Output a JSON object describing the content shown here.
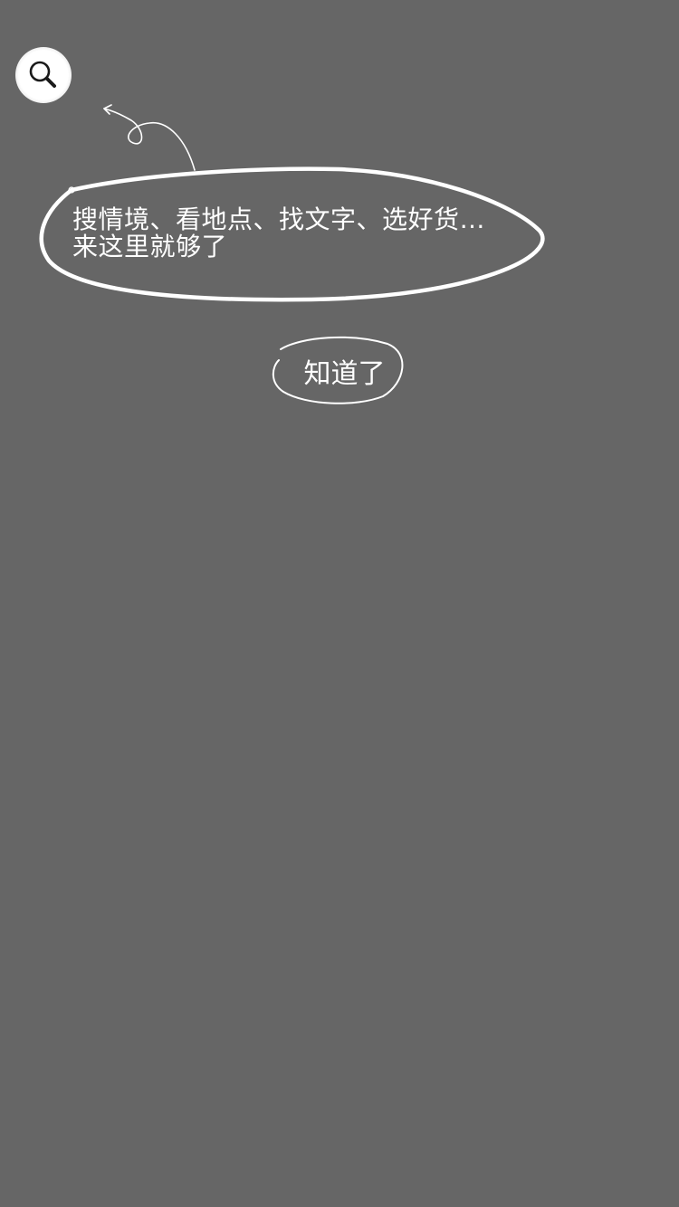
{
  "guide": {
    "icon": "search-icon",
    "tip_line1": "搜情境、看地点、找文字、选好货…",
    "tip_line2": "来这里就够了",
    "dismiss_label": "知道了"
  },
  "colors": {
    "overlay": "#666666",
    "text": "#ffffff",
    "stroke": "#ffffff"
  }
}
